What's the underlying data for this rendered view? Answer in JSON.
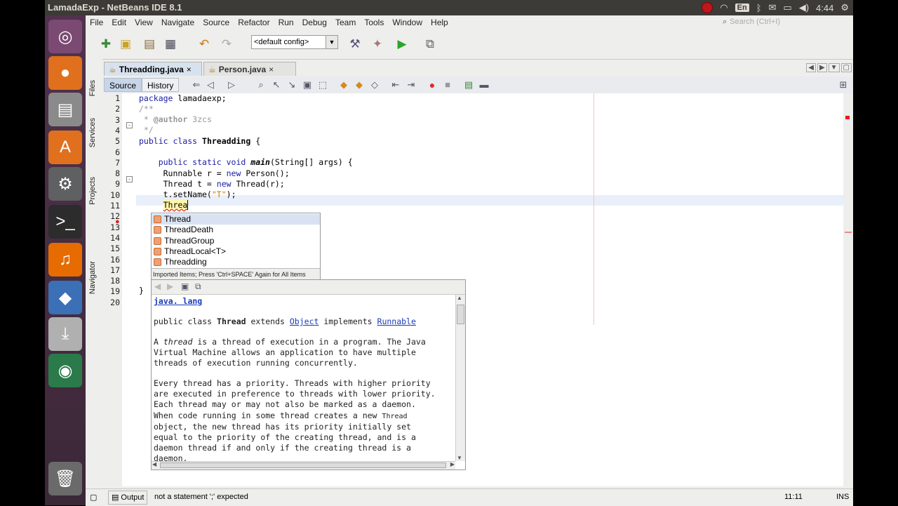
{
  "window": {
    "title": "LamadaExp - NetBeans IDE 8.1"
  },
  "tray": {
    "language": "En",
    "time": "4:44"
  },
  "launcher": [
    {
      "name": "ubuntu-dash-icon",
      "glyph": "◎",
      "bg": "#7a4a72"
    },
    {
      "name": "firefox-icon",
      "glyph": "●",
      "bg": "#e0701d"
    },
    {
      "name": "file-manager-icon",
      "glyph": "▤",
      "bg": "#8a8a8a"
    },
    {
      "name": "software-center-icon",
      "glyph": "A",
      "bg": "#e0701d"
    },
    {
      "name": "system-settings-icon",
      "glyph": "⚙",
      "bg": "#5f6061"
    },
    {
      "name": "terminal-icon",
      "glyph": ">_",
      "bg": "#2c2c2c"
    },
    {
      "name": "audacity-icon",
      "glyph": "♫",
      "bg": "#e66b00"
    },
    {
      "name": "virtualbox-icon",
      "glyph": "◆",
      "bg": "#3b6fb6"
    },
    {
      "name": "installer-icon",
      "glyph": "⤓",
      "bg": "#b0b0b0"
    },
    {
      "name": "netbeans-icon",
      "glyph": "◉",
      "bg": "#2a7a4a"
    },
    {
      "name": "trash-icon",
      "glyph": "🗑",
      "bg": "#6a6a6a"
    }
  ],
  "menu": [
    "File",
    "Edit",
    "View",
    "Navigate",
    "Source",
    "Refactor",
    "Run",
    "Debug",
    "Team",
    "Tools",
    "Window",
    "Help"
  ],
  "search": {
    "placeholder": "Search (Ctrl+I)"
  },
  "toolbar": {
    "config": "<default config>"
  },
  "side_tabs": {
    "files": "Files",
    "services": "Services",
    "projects": "Projects",
    "navigator": "Navigator"
  },
  "editor": {
    "tabs": [
      {
        "label": "Threadding.java",
        "active": true
      },
      {
        "label": "Person.java",
        "active": false
      }
    ],
    "source_label": "Source",
    "history_label": "History"
  },
  "code": {
    "line_numbers": [
      "1",
      "2",
      "3",
      "4",
      "5",
      "6",
      "7",
      "8",
      "9",
      "10",
      "11",
      "12",
      "13",
      "14",
      "15",
      "16",
      "17",
      "18",
      "19",
      "20"
    ]
  },
  "completion": {
    "items": [
      "Thread",
      "ThreadDeath",
      "ThreadGroup",
      "ThreadLocal<T>",
      "Threadding"
    ],
    "footer": "Imported Items; Press 'Ctrl+SPACE' Again for All Items"
  },
  "javadoc": {
    "package": "java. lang",
    "sig_prefix": "public class ",
    "sig_class": "Thread",
    "sig_extends": " extends ",
    "sig_object": "Object",
    "sig_implements": " implements ",
    "sig_runnable": "Runnable"
  },
  "status": {
    "output_label": "Output",
    "message": "not a statement  ';' expected",
    "position": "11:11",
    "mode": "INS"
  }
}
